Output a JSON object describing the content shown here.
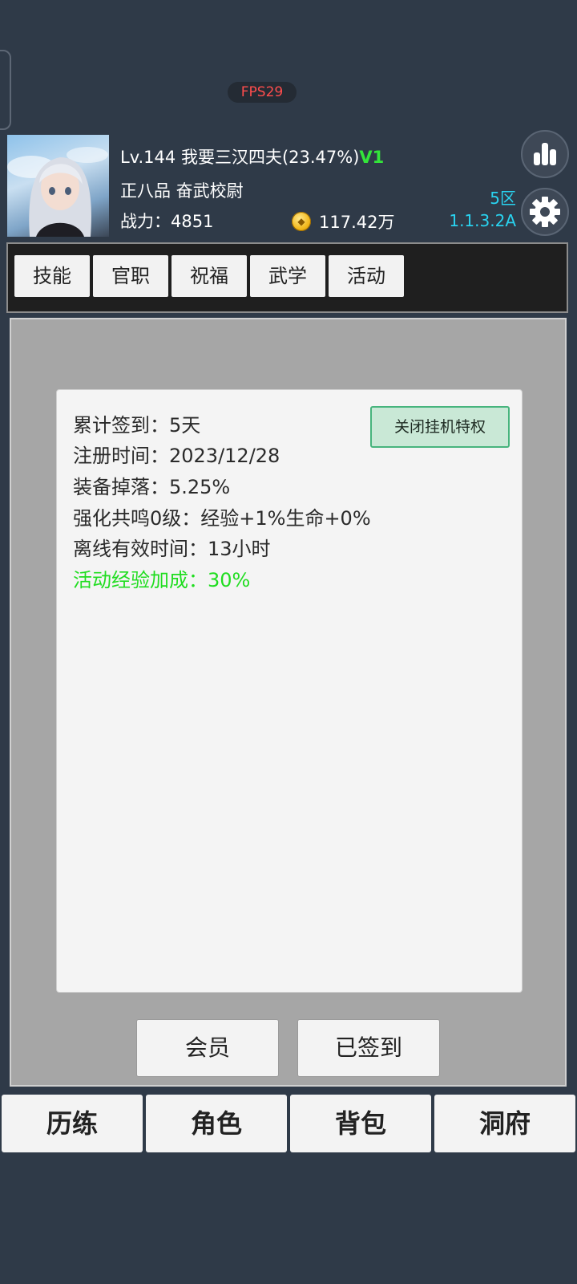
{
  "fps": "FPS29",
  "player": {
    "level": "Lv.144",
    "name": "我要三汉四夫(23.47%)",
    "vip": "V1",
    "rank": "正八品 奋武校尉",
    "power_label": "战力：",
    "power": "4851",
    "coins": "117.42万"
  },
  "server": {
    "zone": "5区",
    "version": "1.1.3.2A"
  },
  "tabs": [
    "技能",
    "官职",
    "祝福",
    "武学",
    "活动"
  ],
  "info": {
    "rows": [
      "累计签到：5天",
      "注册时间：2023/12/28",
      "装备掉落：5.25%",
      "强化共鸣0级：经验+1%生命+0%",
      "离线有效时间：13小时"
    ],
    "highlight": "活动经验加成：30%",
    "close_privilege_label": "关闭挂机特权"
  },
  "actions": {
    "member": "会员",
    "signed_in": "已签到"
  },
  "nav": [
    "历练",
    "角色",
    "背包",
    "洞府"
  ]
}
